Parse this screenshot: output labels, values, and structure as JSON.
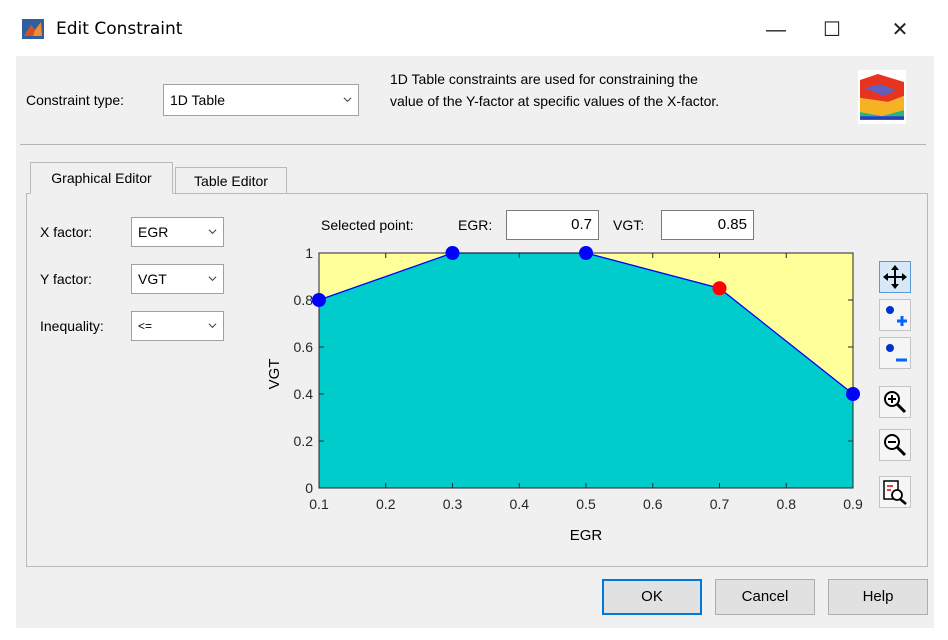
{
  "window": {
    "title": "Edit Constraint",
    "minimize": "—",
    "maximize": "☐",
    "close": "✕"
  },
  "constraint": {
    "label": "Constraint type:",
    "value": "1D Table",
    "description_line1": "1D Table constraints are used for constraining the",
    "description_line2": "value of the Y-factor at specific values of the X-factor."
  },
  "tabs": [
    {
      "label": "Graphical Editor",
      "selected": true
    },
    {
      "label": "Table Editor",
      "selected": false
    }
  ],
  "factors": {
    "x_label": "X factor:",
    "x_value": "EGR",
    "y_label": "Y factor:",
    "y_value": "VGT",
    "inequality_label": "Inequality:",
    "inequality_value": "<="
  },
  "selected_point": {
    "label": "Selected point:",
    "x_name": "EGR:",
    "x_value": "0.7",
    "y_name": "VGT:",
    "y_value": "0.85"
  },
  "toolbar": {
    "icons": [
      "move-icon",
      "add-point-icon",
      "remove-point-icon",
      "zoom-in-icon",
      "zoom-out-icon",
      "reset-zoom-icon"
    ]
  },
  "buttons": {
    "ok": "OK",
    "cancel": "Cancel",
    "help": "Help"
  },
  "chart_data": {
    "type": "area",
    "xlabel": "EGR",
    "ylabel": "VGT",
    "xlim": [
      0.1,
      0.9
    ],
    "ylim": [
      0,
      1
    ],
    "x_ticks": [
      "0.1",
      "0.2",
      "0.3",
      "0.4",
      "0.5",
      "0.6",
      "0.7",
      "0.8",
      "0.9"
    ],
    "y_ticks": [
      "0",
      "0.2",
      "0.4",
      "0.6",
      "0.8",
      "1"
    ],
    "x": [
      0.1,
      0.3,
      0.5,
      0.7,
      0.9
    ],
    "y": [
      0.8,
      1.0,
      1.0,
      0.85,
      0.4
    ],
    "selected_index": 3,
    "colors": {
      "feasible": "#00cccc",
      "infeasible": "#ffff99",
      "line": "#0000ff",
      "point": "#0000ff",
      "selected_point": "#ff0000"
    },
    "grid": false
  }
}
